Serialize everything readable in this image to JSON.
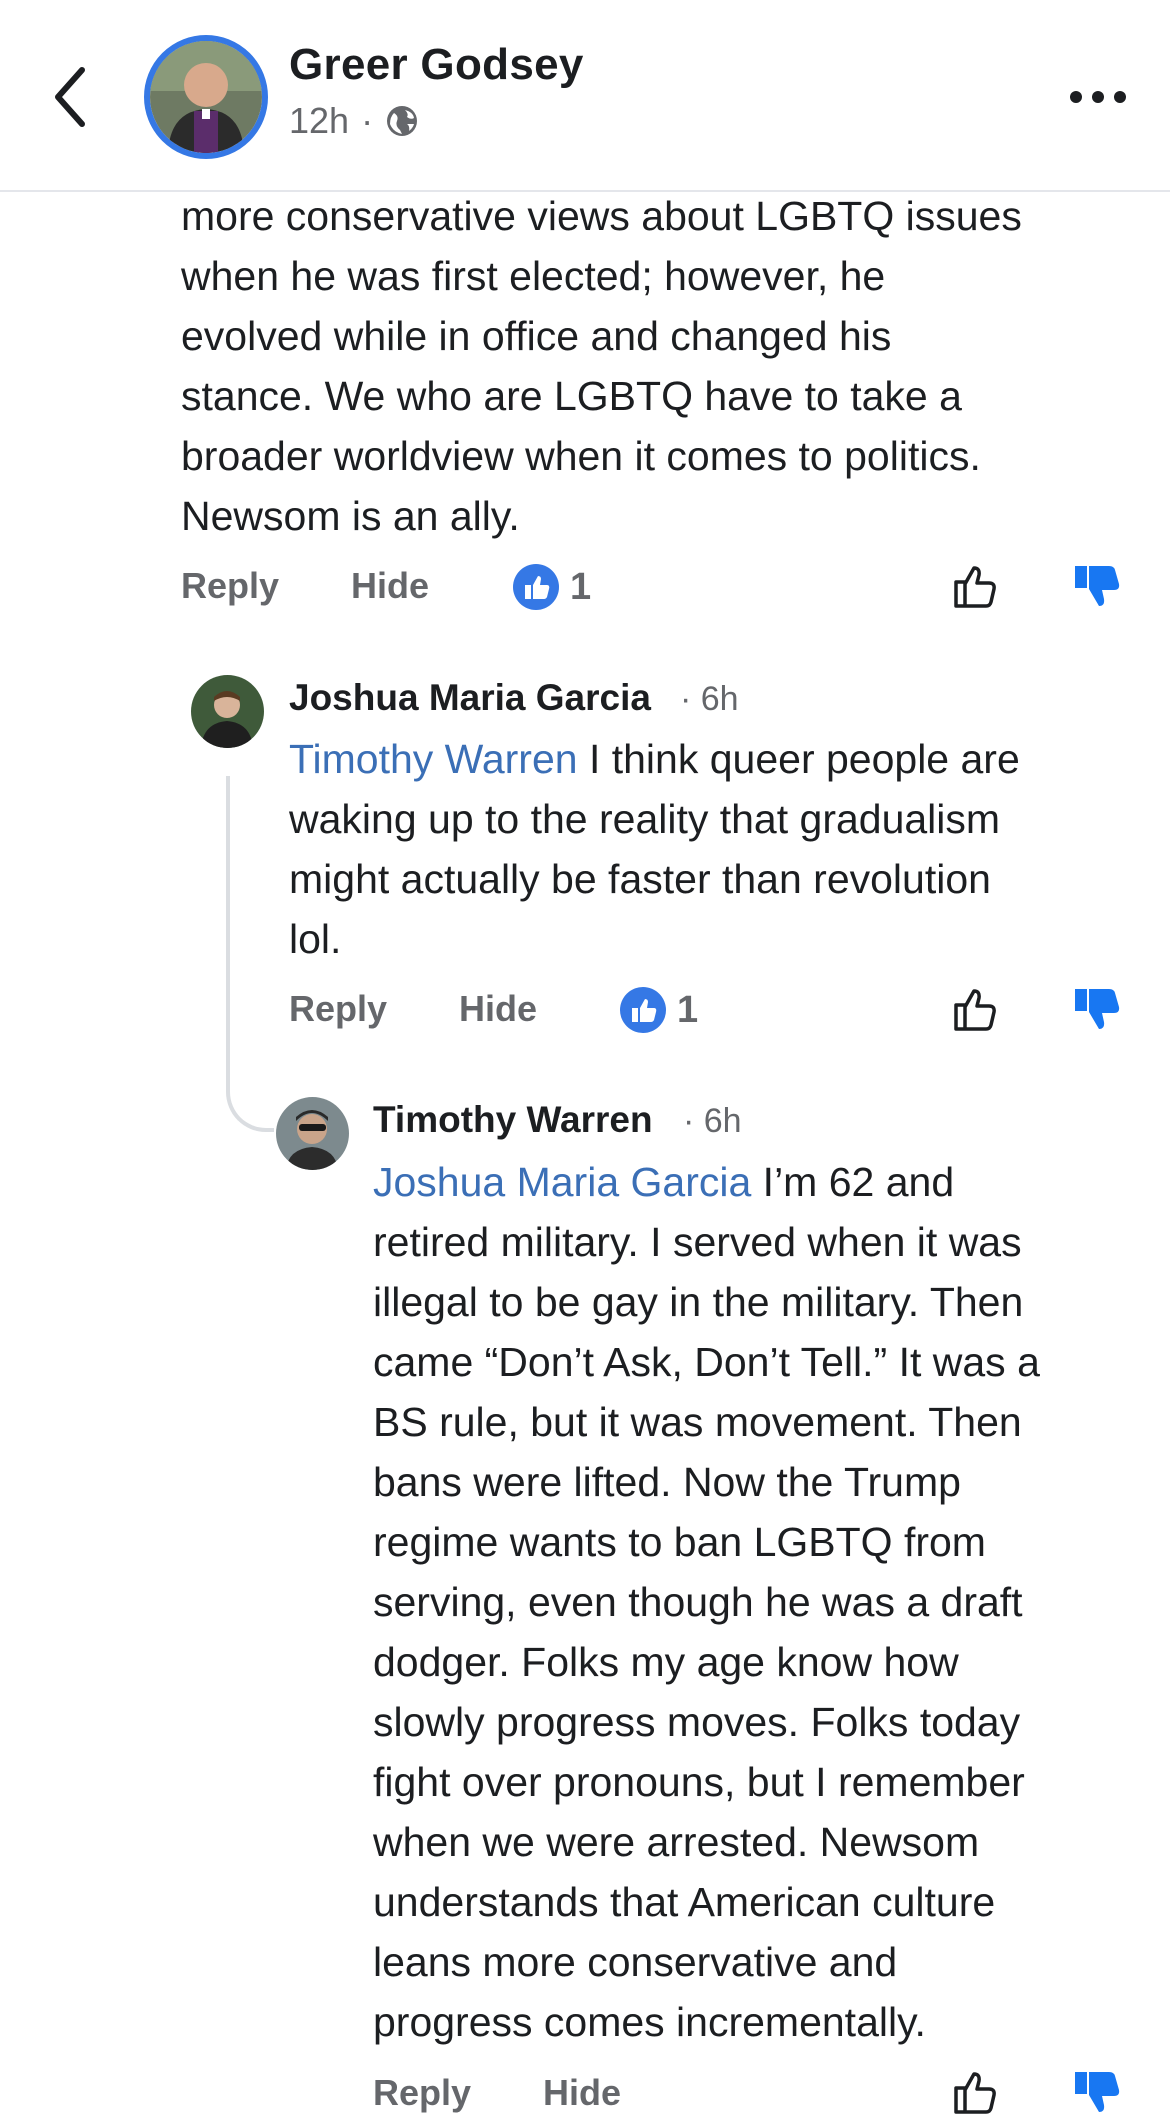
{
  "header": {
    "name": "Greer Godsey",
    "time": "12h",
    "dot": "·",
    "privacy_icon": "globe-icon"
  },
  "comments": [
    {
      "lines": [
        "more conservative views about LGBTQ issues",
        "when he was first elected; however, he",
        "evolved while in office and changed his",
        "stance. We who are LGBTQ have to take a",
        "broader worldview when it comes to politics.",
        "Newsom is an ally."
      ],
      "reply_label": "Reply",
      "hide_label": "Hide",
      "reaction_count": "1"
    },
    {
      "author": "Joshua Maria Garcia",
      "time": "· 6h",
      "mention": "Timothy Warren",
      "first_line_rest": " I think queer people are",
      "lines": [
        "waking up to the reality that gradualism",
        "might actually be faster than revolution",
        "lol."
      ],
      "reply_label": "Reply",
      "hide_label": "Hide",
      "reaction_count": "1"
    },
    {
      "author": "Timothy Warren",
      "time": "· 6h",
      "mention": "Joshua Maria Garcia",
      "first_line_rest": " I’m 62 and",
      "lines": [
        "retired military. I served when it was",
        "illegal to be gay in the military. Then",
        "came “Don’t Ask, Don’t Tell.” It was a",
        "BS rule, but it was movement. Then",
        "bans were lifted. Now the Trump",
        "regime wants to ban LGBTQ from",
        "serving, even though he was a draft",
        "dodger. Folks my age know how",
        "slowly progress moves. Folks today",
        "fight over pronouns, but I remember",
        "when we were arrested. Newsom",
        "understands that American culture",
        "leans more conservative and",
        "progress comes incrementally."
      ],
      "reply_label": "Reply",
      "hide_label": "Hide"
    }
  ],
  "colors": {
    "accent": "#3578e5",
    "mention": "#3b6fb6",
    "downvote": "#1877f2",
    "secondary_text": "#65676b"
  }
}
